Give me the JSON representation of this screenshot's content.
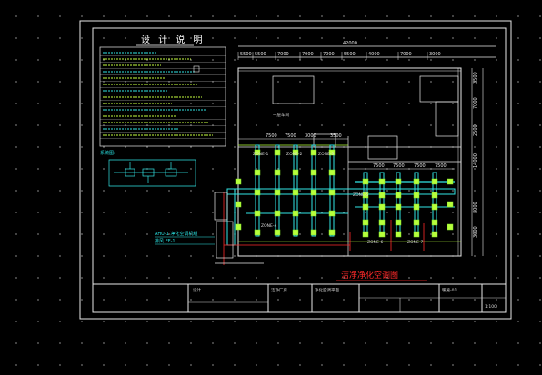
{
  "drawing": {
    "notes_title": "设 计 说 明",
    "plan_title": "洁净净化空调图",
    "total_width_dim": "42000",
    "top_dims": [
      "5500",
      "5500",
      "7000",
      "7000",
      "7000",
      "5500",
      "4000",
      "7000",
      "3000"
    ],
    "right_dims": [
      "3500",
      "7000",
      "2500",
      "14000",
      "3000",
      "3000"
    ],
    "middle_dims": [
      "7500",
      "7500",
      "3000",
      "3500",
      "7500",
      "7500",
      "7500",
      "7500"
    ],
    "room_label": "一层车间",
    "zone_labels": [
      "ZONE-1",
      "ZONE-2",
      "ZONE-3",
      "ZONE-4",
      "ZONE-5",
      "ZONE-6",
      "ZONE-7"
    ],
    "detail_notes": [
      "AHU-1 净化空调机组",
      "排风 EF-1"
    ],
    "title_block": {
      "designer": "设计",
      "project": "洁净厂房",
      "sheet_name": "净化空调平面",
      "drawing_no": "暖施-01",
      "scale": "1:100"
    }
  },
  "colors": {
    "background": "#000000",
    "linework": "#e8e8e8",
    "duct": "#32e6e6",
    "diffuser": "#b7ff3c",
    "accent": "#ff2a2a",
    "grid": "#9a9a9a"
  }
}
